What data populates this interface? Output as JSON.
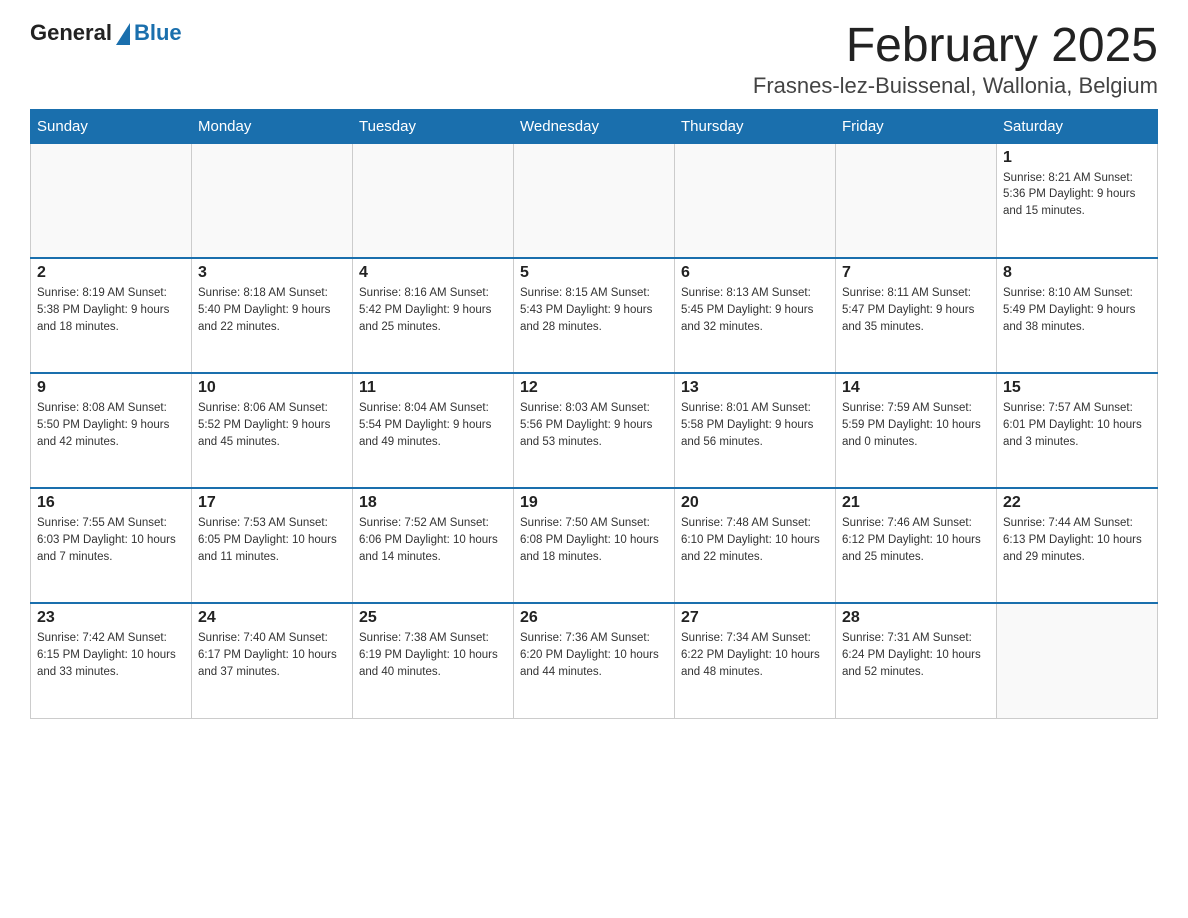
{
  "header": {
    "logo_general": "General",
    "logo_blue": "Blue",
    "title": "February 2025",
    "subtitle": "Frasnes-lez-Buissenal, Wallonia, Belgium"
  },
  "days_of_week": [
    "Sunday",
    "Monday",
    "Tuesday",
    "Wednesday",
    "Thursday",
    "Friday",
    "Saturday"
  ],
  "weeks": [
    [
      {
        "day": "",
        "info": ""
      },
      {
        "day": "",
        "info": ""
      },
      {
        "day": "",
        "info": ""
      },
      {
        "day": "",
        "info": ""
      },
      {
        "day": "",
        "info": ""
      },
      {
        "day": "",
        "info": ""
      },
      {
        "day": "1",
        "info": "Sunrise: 8:21 AM\nSunset: 5:36 PM\nDaylight: 9 hours\nand 15 minutes."
      }
    ],
    [
      {
        "day": "2",
        "info": "Sunrise: 8:19 AM\nSunset: 5:38 PM\nDaylight: 9 hours\nand 18 minutes."
      },
      {
        "day": "3",
        "info": "Sunrise: 8:18 AM\nSunset: 5:40 PM\nDaylight: 9 hours\nand 22 minutes."
      },
      {
        "day": "4",
        "info": "Sunrise: 8:16 AM\nSunset: 5:42 PM\nDaylight: 9 hours\nand 25 minutes."
      },
      {
        "day": "5",
        "info": "Sunrise: 8:15 AM\nSunset: 5:43 PM\nDaylight: 9 hours\nand 28 minutes."
      },
      {
        "day": "6",
        "info": "Sunrise: 8:13 AM\nSunset: 5:45 PM\nDaylight: 9 hours\nand 32 minutes."
      },
      {
        "day": "7",
        "info": "Sunrise: 8:11 AM\nSunset: 5:47 PM\nDaylight: 9 hours\nand 35 minutes."
      },
      {
        "day": "8",
        "info": "Sunrise: 8:10 AM\nSunset: 5:49 PM\nDaylight: 9 hours\nand 38 minutes."
      }
    ],
    [
      {
        "day": "9",
        "info": "Sunrise: 8:08 AM\nSunset: 5:50 PM\nDaylight: 9 hours\nand 42 minutes."
      },
      {
        "day": "10",
        "info": "Sunrise: 8:06 AM\nSunset: 5:52 PM\nDaylight: 9 hours\nand 45 minutes."
      },
      {
        "day": "11",
        "info": "Sunrise: 8:04 AM\nSunset: 5:54 PM\nDaylight: 9 hours\nand 49 minutes."
      },
      {
        "day": "12",
        "info": "Sunrise: 8:03 AM\nSunset: 5:56 PM\nDaylight: 9 hours\nand 53 minutes."
      },
      {
        "day": "13",
        "info": "Sunrise: 8:01 AM\nSunset: 5:58 PM\nDaylight: 9 hours\nand 56 minutes."
      },
      {
        "day": "14",
        "info": "Sunrise: 7:59 AM\nSunset: 5:59 PM\nDaylight: 10 hours\nand 0 minutes."
      },
      {
        "day": "15",
        "info": "Sunrise: 7:57 AM\nSunset: 6:01 PM\nDaylight: 10 hours\nand 3 minutes."
      }
    ],
    [
      {
        "day": "16",
        "info": "Sunrise: 7:55 AM\nSunset: 6:03 PM\nDaylight: 10 hours\nand 7 minutes."
      },
      {
        "day": "17",
        "info": "Sunrise: 7:53 AM\nSunset: 6:05 PM\nDaylight: 10 hours\nand 11 minutes."
      },
      {
        "day": "18",
        "info": "Sunrise: 7:52 AM\nSunset: 6:06 PM\nDaylight: 10 hours\nand 14 minutes."
      },
      {
        "day": "19",
        "info": "Sunrise: 7:50 AM\nSunset: 6:08 PM\nDaylight: 10 hours\nand 18 minutes."
      },
      {
        "day": "20",
        "info": "Sunrise: 7:48 AM\nSunset: 6:10 PM\nDaylight: 10 hours\nand 22 minutes."
      },
      {
        "day": "21",
        "info": "Sunrise: 7:46 AM\nSunset: 6:12 PM\nDaylight: 10 hours\nand 25 minutes."
      },
      {
        "day": "22",
        "info": "Sunrise: 7:44 AM\nSunset: 6:13 PM\nDaylight: 10 hours\nand 29 minutes."
      }
    ],
    [
      {
        "day": "23",
        "info": "Sunrise: 7:42 AM\nSunset: 6:15 PM\nDaylight: 10 hours\nand 33 minutes."
      },
      {
        "day": "24",
        "info": "Sunrise: 7:40 AM\nSunset: 6:17 PM\nDaylight: 10 hours\nand 37 minutes."
      },
      {
        "day": "25",
        "info": "Sunrise: 7:38 AM\nSunset: 6:19 PM\nDaylight: 10 hours\nand 40 minutes."
      },
      {
        "day": "26",
        "info": "Sunrise: 7:36 AM\nSunset: 6:20 PM\nDaylight: 10 hours\nand 44 minutes."
      },
      {
        "day": "27",
        "info": "Sunrise: 7:34 AM\nSunset: 6:22 PM\nDaylight: 10 hours\nand 48 minutes."
      },
      {
        "day": "28",
        "info": "Sunrise: 7:31 AM\nSunset: 6:24 PM\nDaylight: 10 hours\nand 52 minutes."
      },
      {
        "day": "",
        "info": ""
      }
    ]
  ]
}
